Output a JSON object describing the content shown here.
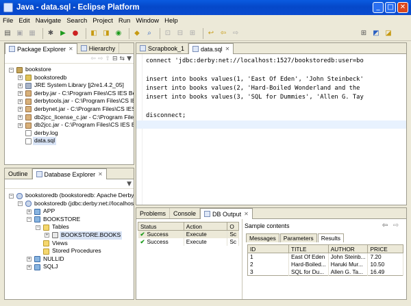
{
  "window": {
    "title": "Java - data.sql - Eclipse Platform",
    "minimize": "_",
    "maximize": "□",
    "close": "✕"
  },
  "menu": [
    "File",
    "Edit",
    "Navigate",
    "Search",
    "Project",
    "Run",
    "Window",
    "Help"
  ],
  "package_explorer": {
    "tabs": [
      {
        "label": "Package Explorer",
        "active": true
      },
      {
        "label": "Hierarchy",
        "active": false
      }
    ],
    "tree": [
      {
        "label": "bookstore",
        "level": 0,
        "icon": "project-icon",
        "expander": "−"
      },
      {
        "label": "bookstoredb",
        "level": 1,
        "icon": "package-icon",
        "expander": "+"
      },
      {
        "label": "JRE System Library [j2re1.4.2_05]",
        "level": 1,
        "icon": "library-icon",
        "expander": "+"
      },
      {
        "label": "derby.jar - C:\\Program Files\\CS IES Be",
        "level": 1,
        "icon": "jar-icon",
        "expander": "+"
      },
      {
        "label": "derbytools.jar - C:\\Program Files\\CS IES",
        "level": 1,
        "icon": "jar-icon",
        "expander": "+"
      },
      {
        "label": "derbynet.jar - C:\\Program Files\\CS IES",
        "level": 1,
        "icon": "jar-icon",
        "expander": "+"
      },
      {
        "label": "db2jcc_license_c.jar - C:\\Program Files",
        "level": 1,
        "icon": "jar-icon",
        "expander": "+"
      },
      {
        "label": "db2jcc.jar - C:\\Program Files\\CS IES Be",
        "level": 1,
        "icon": "jar-icon",
        "expander": "+"
      },
      {
        "label": "derby.log",
        "level": 1,
        "icon": "file-icon",
        "expander": ""
      },
      {
        "label": "data.sql",
        "level": 1,
        "icon": "file-icon",
        "expander": "",
        "selected": true
      }
    ]
  },
  "database_explorer": {
    "tabs": [
      {
        "label": "Outline",
        "active": false
      },
      {
        "label": "Database Explorer",
        "active": true
      }
    ],
    "tree": [
      {
        "label": "bookstoredb (bookstoredb: Apache Derby",
        "level": 0,
        "icon": "database-icon",
        "expander": "−"
      },
      {
        "label": "bookstoredb (jdbc:derby:net://localhos",
        "level": 1,
        "icon": "database-icon",
        "expander": "−"
      },
      {
        "label": "APP",
        "level": 2,
        "icon": "schema-icon",
        "expander": "+"
      },
      {
        "label": "BOOKSTORE",
        "level": 2,
        "icon": "schema-icon",
        "expander": "−"
      },
      {
        "label": "Tables",
        "level": 3,
        "icon": "folder-icon",
        "expander": "−"
      },
      {
        "label": "BOOKSTORE.BOOKS",
        "level": 4,
        "icon": "table-icon",
        "expander": "+",
        "selected": true
      },
      {
        "label": "Views",
        "level": 3,
        "icon": "folder-icon",
        "expander": ""
      },
      {
        "label": "Stored Procedures",
        "level": 3,
        "icon": "folder-icon",
        "expander": ""
      },
      {
        "label": "NULLID",
        "level": 2,
        "icon": "schema-icon",
        "expander": "+"
      },
      {
        "label": "SQLJ",
        "level": 2,
        "icon": "schema-icon",
        "expander": "+"
      }
    ]
  },
  "editor": {
    "tabs": [
      {
        "label": "Scrapbook_1",
        "active": false
      },
      {
        "label": "data.sql",
        "active": true
      }
    ],
    "lines": [
      {
        "text": "connect 'jdbc:derby:net://localhost:1527/bookstoredb:user=bo",
        "current": false
      },
      {
        "text": "",
        "current": false
      },
      {
        "text": "insert into books values(1, 'East Of Eden', 'John Steinbeck'",
        "current": false
      },
      {
        "text": "insert into books values(2, 'Hard-Boiled Wonderland and the",
        "current": false
      },
      {
        "text": "insert into books values(3, 'SQL for Dummies', 'Allen G. Tay",
        "current": false
      },
      {
        "text": "",
        "current": false
      },
      {
        "text": "disconnect;",
        "current": false
      },
      {
        "text": "",
        "current": true
      }
    ]
  },
  "output": {
    "tabs": [
      {
        "label": "Problems",
        "active": false
      },
      {
        "label": "Console",
        "active": false
      },
      {
        "label": "DB Output",
        "active": true
      }
    ],
    "columns": [
      "Status",
      "Action",
      "O"
    ],
    "rows": [
      {
        "status": "Success",
        "action": "Execute",
        "o": "Sc"
      },
      {
        "status": "Success",
        "action": "Execute",
        "o": "Sc"
      }
    ],
    "sample_title": "Sample contents",
    "subtabs": [
      {
        "label": "Messages",
        "active": false
      },
      {
        "label": "Parameters",
        "active": false
      },
      {
        "label": "Results",
        "active": true
      }
    ],
    "result_columns": [
      "ID",
      "TITLE",
      "AUTHOR",
      "PRICE"
    ],
    "result_rows": [
      [
        "1",
        "East Of Eden",
        "John Steinb...",
        "7.20"
      ],
      [
        "2",
        "Hard-Boiled...",
        "Haruki Mur...",
        "10.50"
      ],
      [
        "3",
        "SQL for Du...",
        "Allen G. Ta...",
        "16.49"
      ]
    ]
  }
}
